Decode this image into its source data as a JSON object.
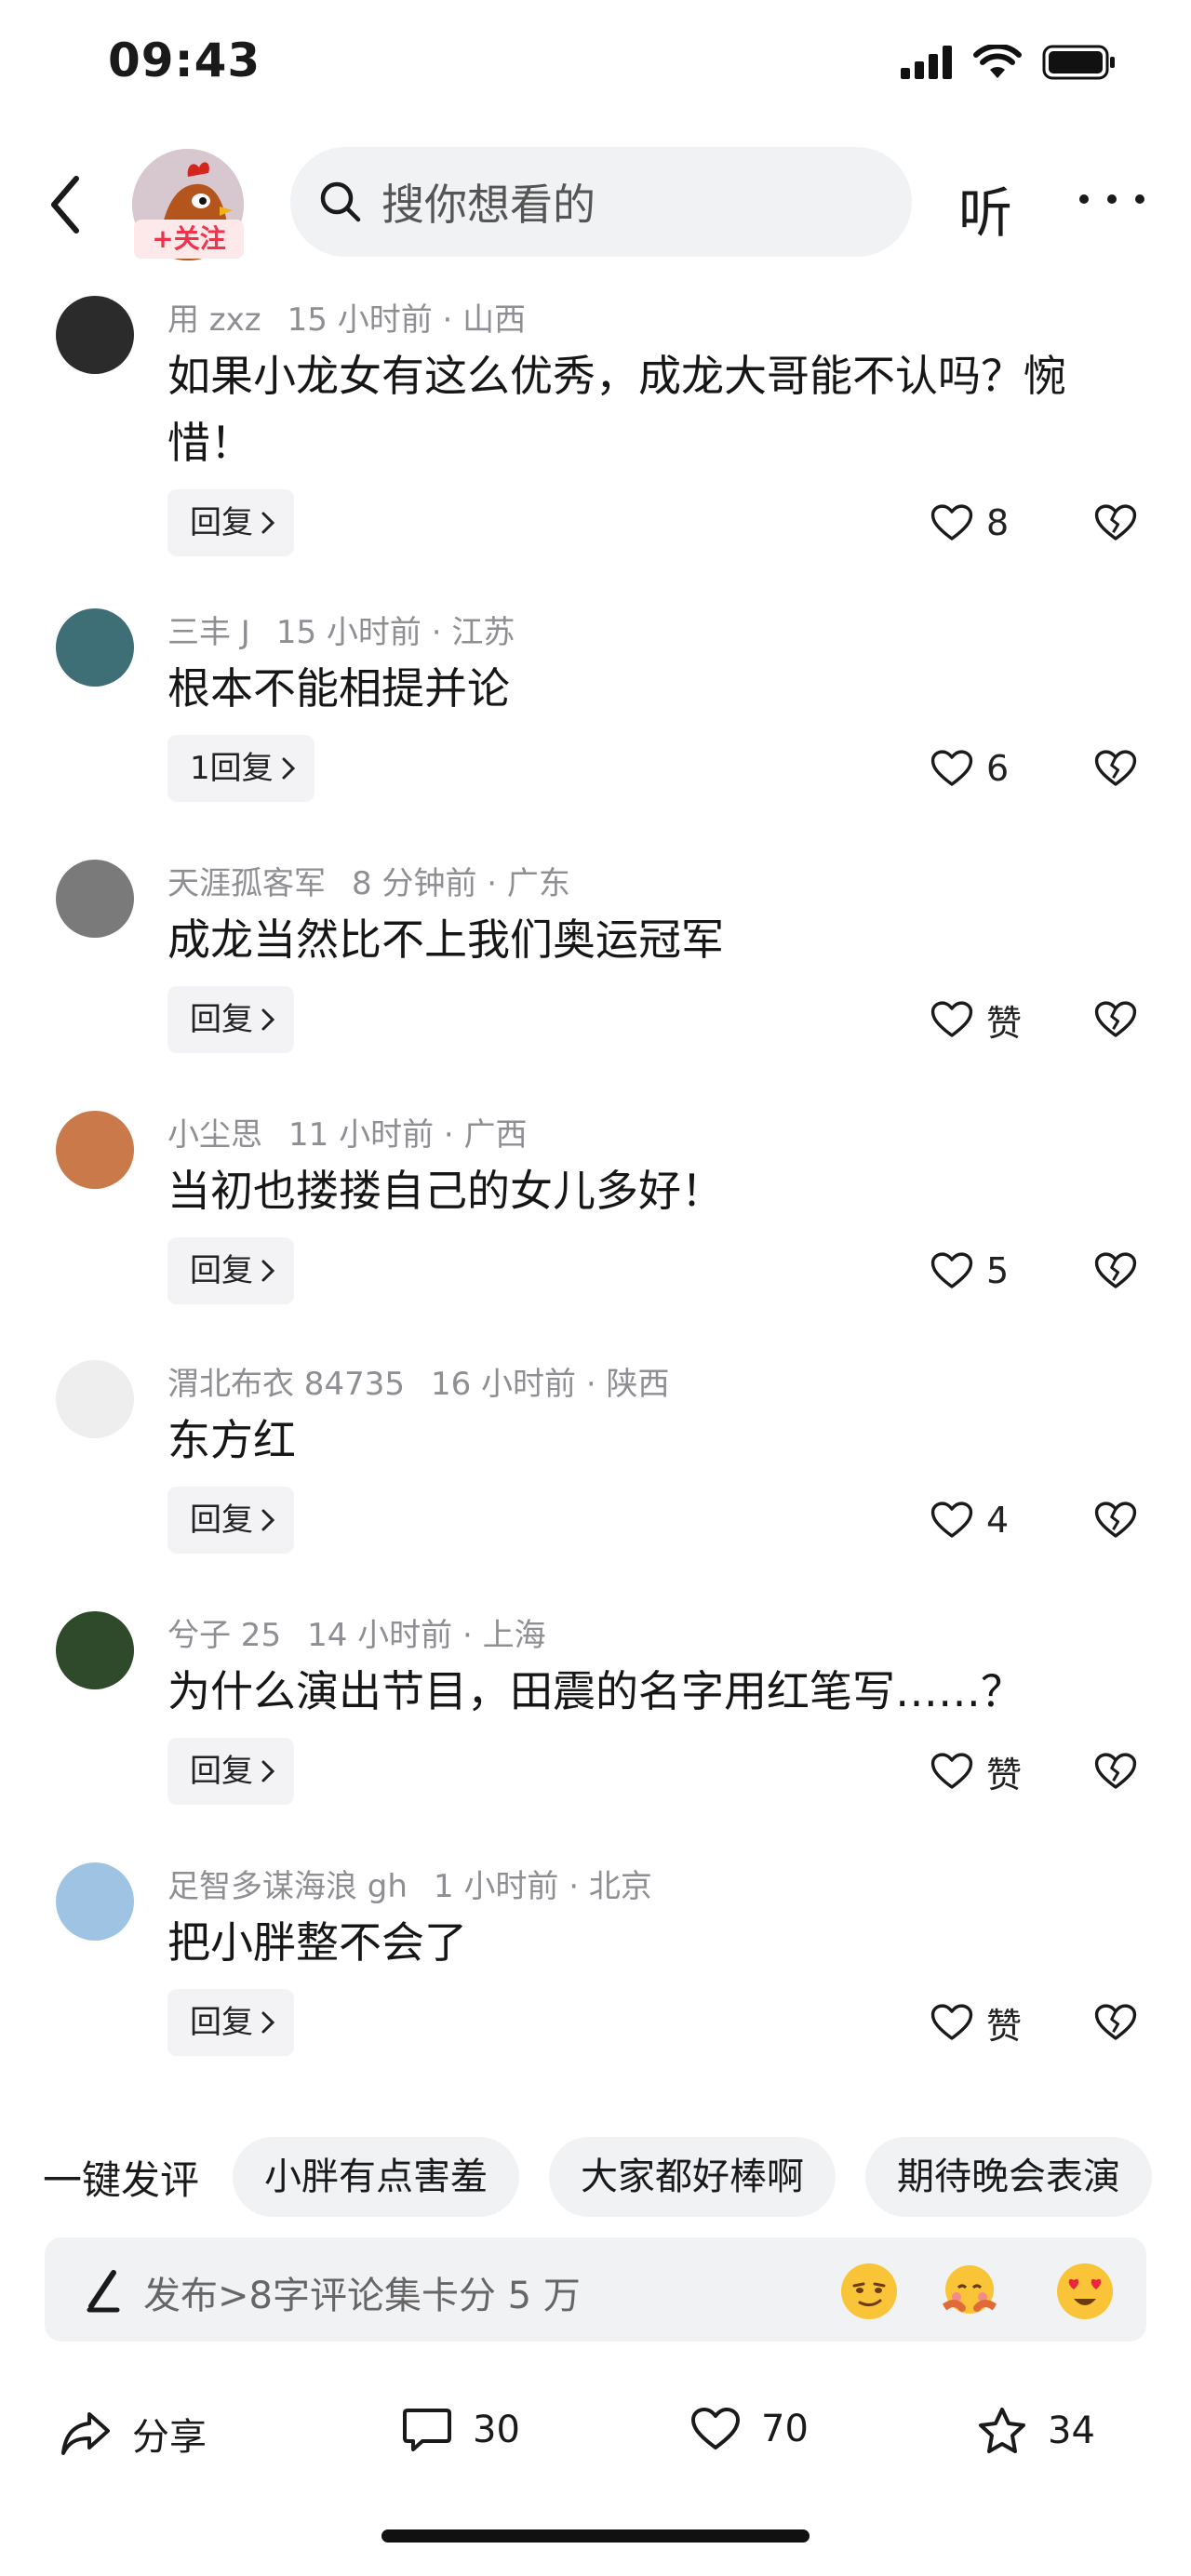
{
  "status_bar": {
    "time": "09:43"
  },
  "nav": {
    "follow_label": "+关注",
    "search_placeholder": "搜你想看的",
    "listen_label": "听"
  },
  "comments": [
    {
      "user": "用 zxz",
      "time": "15 小时前",
      "location": "山西",
      "text": "如果小龙女有这么优秀，成龙大哥能不认吗？惋惜！",
      "reply_label": "回复",
      "likes": "8",
      "avatar_color": "#2b2b2b"
    },
    {
      "user": "三丰 J",
      "time": "15 小时前",
      "location": "江苏",
      "text": "根本不能相提并论",
      "reply_label": "1回复",
      "likes": "6",
      "avatar_color": "#3e6e76"
    },
    {
      "user": "天涯孤客军",
      "time": "8 分钟前",
      "location": "广东",
      "text": "成龙当然比不上我们奥运冠军",
      "reply_label": "回复",
      "likes": "赞",
      "avatar_color": "#7a7a7a"
    },
    {
      "user": "小尘思",
      "time": "11 小时前",
      "location": "广西",
      "text": "当初也搂搂自己的女儿多好！",
      "reply_label": "回复",
      "likes": "5",
      "avatar_color": "#c9794a"
    },
    {
      "user": "渭北布衣 84735",
      "time": "16 小时前",
      "location": "陕西",
      "text": "东方红",
      "reply_label": "回复",
      "likes": "4",
      "avatar_color": "#eeeeee"
    },
    {
      "user": "兮子 25",
      "time": "14 小时前",
      "location": "上海",
      "text": "为什么演出节目，田震的名字用红笔写……？",
      "reply_label": "回复",
      "likes": "赞",
      "avatar_color": "#2f4a2a"
    },
    {
      "user": "足智多谋海浪 gh",
      "time": "1 小时前",
      "location": "北京",
      "text": "把小胖整不会了",
      "reply_label": "回复",
      "likes": "赞",
      "avatar_color": "#9fc4e3"
    }
  ],
  "quick_comments": {
    "title": "一键发评",
    "chips": [
      "小胖有点害羞",
      "大家都好棒啊",
      "期待晚会表演"
    ]
  },
  "compose": {
    "placeholder": "发布>8字评论集卡分 5 万"
  },
  "actions": {
    "share_label": "分享",
    "comment_count": "30",
    "like_count": "70",
    "favorite_count": "34"
  },
  "colors": {
    "accent": "#f0324b",
    "chip_bg": "#f1f2f4",
    "meta_text": "#8e8e93"
  }
}
